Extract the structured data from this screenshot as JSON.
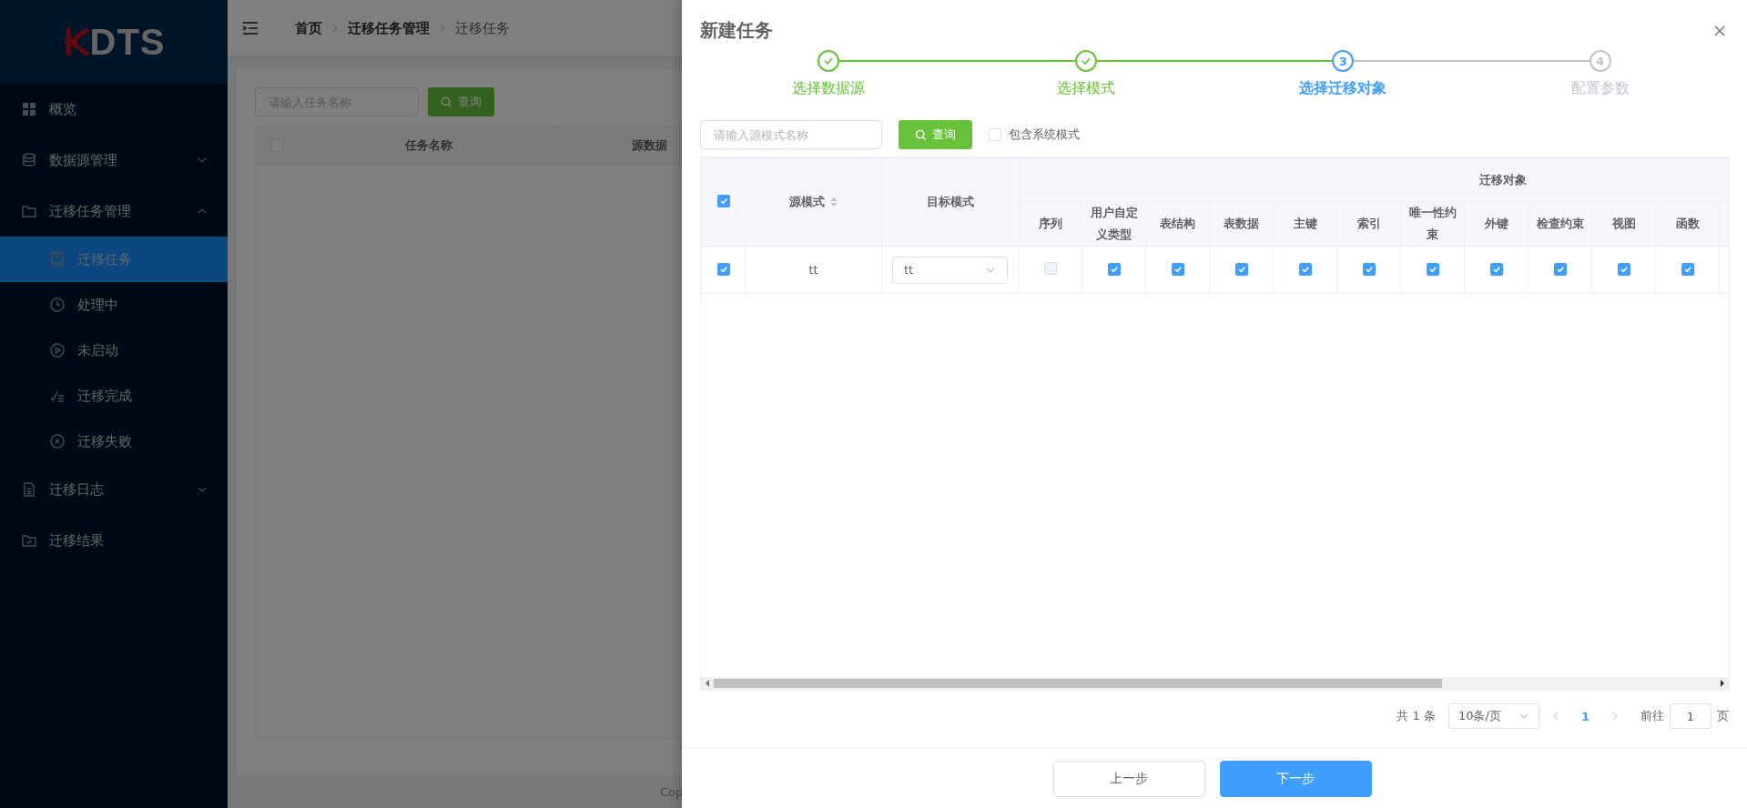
{
  "sidebar": {
    "logo": "DTS",
    "menu": [
      {
        "kind": "item",
        "label": "概览"
      },
      {
        "kind": "group",
        "label": "数据源管理",
        "expanded": false
      },
      {
        "kind": "group",
        "label": "迁移任务管理",
        "expanded": true,
        "children": [
          {
            "label": "迁移任务",
            "selected": true
          },
          {
            "label": "处理中",
            "selected": false
          },
          {
            "label": "未启动",
            "selected": false
          },
          {
            "label": "迁移完成",
            "selected": false
          },
          {
            "label": "迁移失败",
            "selected": false
          }
        ]
      },
      {
        "kind": "group",
        "label": "迁移日志",
        "expanded": false
      },
      {
        "kind": "item",
        "label": "迁移结果"
      }
    ]
  },
  "breadcrumb": [
    "首页",
    "迁移任务管理",
    "迁移任务"
  ],
  "page": {
    "search": {
      "placeholder": "请输入任务名称"
    },
    "search_button": "查询",
    "table": {
      "select_all": false,
      "columns": [
        "任务名称",
        "源数据"
      ]
    },
    "footer": "Cop"
  },
  "drawer": {
    "title": "新建任务",
    "steps": [
      {
        "label": "选择数据源",
        "completed": true,
        "selected": false
      },
      {
        "label": "选择模式",
        "completed": true,
        "selected": false
      },
      {
        "label": "选择迁移对象",
        "completed": false,
        "selected": true,
        "number": "3"
      },
      {
        "label": "配置参数",
        "completed": false,
        "selected": false,
        "number": "4"
      }
    ],
    "search": {
      "placeholder": "请输入源模式名称"
    },
    "search_button": "查询",
    "include_system": {
      "label": "包含系统模式",
      "checked": false
    },
    "table": {
      "select_all": true,
      "columns": {
        "source": "源模式",
        "target": "目标模式",
        "group": "迁移对象"
      },
      "objects": [
        "序列",
        "用户自定义类型",
        "表结构",
        "表数据",
        "主键",
        "索引",
        "唯一性约束",
        "外键",
        "检查约束",
        "视图",
        "函数"
      ],
      "rows": [
        {
          "selected": true,
          "source": "tt",
          "target": "tt",
          "objects": [
            {
              "checked": false,
              "disabled": true
            },
            {
              "checked": true,
              "disabled": false
            },
            {
              "checked": true,
              "disabled": false
            },
            {
              "checked": true,
              "disabled": false
            },
            {
              "checked": true,
              "disabled": false
            },
            {
              "checked": true,
              "disabled": false
            },
            {
              "checked": true,
              "disabled": false
            },
            {
              "checked": true,
              "disabled": false
            },
            {
              "checked": true,
              "disabled": false
            },
            {
              "checked": true,
              "disabled": false
            },
            {
              "checked": true,
              "disabled": false
            }
          ]
        }
      ]
    },
    "pagination": {
      "total": "共 1 条",
      "page_size": "10条/页",
      "pages": [
        {
          "label": "1",
          "selected": true
        }
      ],
      "goto_label": "前往",
      "goto_value": "1",
      "page_unit": "页"
    },
    "buttons": {
      "prev": "上一步",
      "next": "下一步"
    }
  }
}
